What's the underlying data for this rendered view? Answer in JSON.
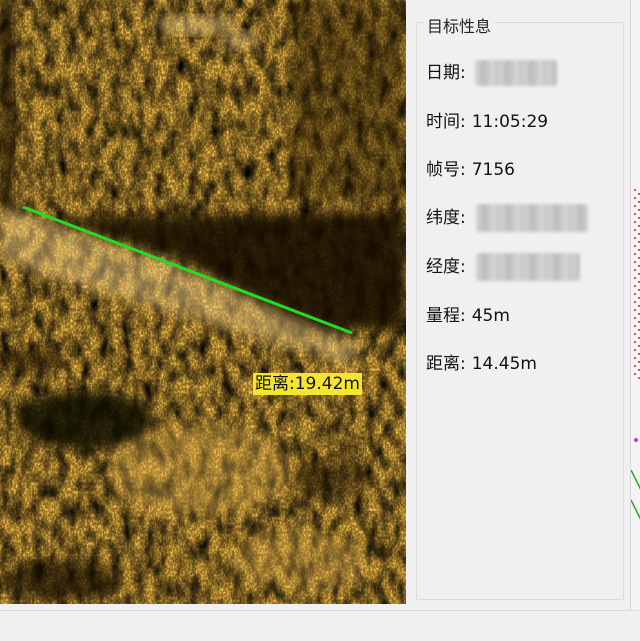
{
  "measurement": {
    "label": "距离:19.42m"
  },
  "target_info": {
    "title": "目标性息",
    "fields": [
      {
        "label": "日期:",
        "value": "",
        "redacted": true
      },
      {
        "label": "时间:",
        "value": "11:05:29",
        "redacted": false
      },
      {
        "label": "帧号:",
        "value": "7156",
        "redacted": false
      },
      {
        "label": "纬度:",
        "value": "",
        "redacted": true
      },
      {
        "label": "经度:",
        "value": "",
        "redacted": true
      },
      {
        "label": "量程:",
        "value": "45m",
        "redacted": false
      },
      {
        "label": "距离:",
        "value": "14.45m",
        "redacted": false
      }
    ]
  },
  "colors": {
    "sonar_palette": "#c8901c",
    "measure_line": "#22dd22",
    "label_background": "#f5e530",
    "target_markers": "#e02020"
  }
}
